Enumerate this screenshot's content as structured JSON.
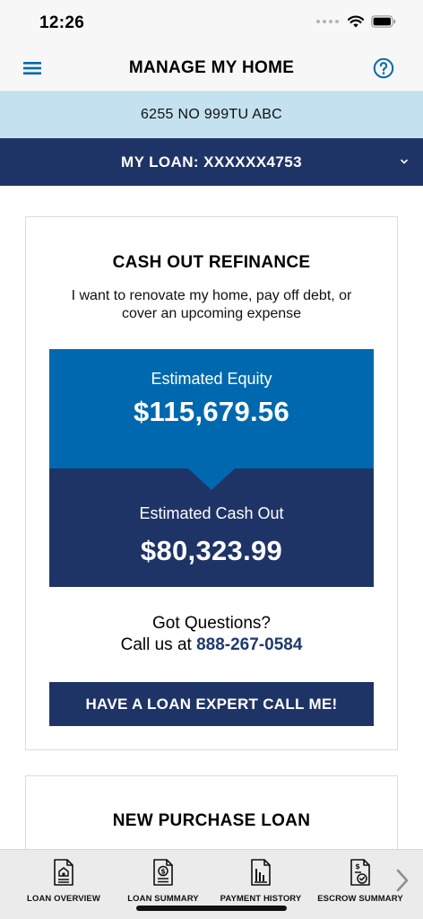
{
  "status_bar": {
    "time": "12:26"
  },
  "header": {
    "title": "MANAGE MY HOME"
  },
  "address": "6255 NO 999TU ABC",
  "loan_selector": {
    "label": "MY LOAN: XXXXXX4753"
  },
  "refinance_card": {
    "title": "CASH OUT REFINANCE",
    "description": "I want to renovate my home, pay off debt, or cover an upcoming expense",
    "equity_label": "Estimated Equity",
    "equity_value": "$115,679.56",
    "cashout_label": "Estimated Cash Out",
    "cashout_value": "$80,323.99",
    "questions_line": "Got Questions?",
    "call_prefix": "Call us at ",
    "phone": "888-267-0584",
    "cta_label": "HAVE A LOAN EXPERT CALL ME!"
  },
  "purchase_card": {
    "title": "NEW PURCHASE LOAN"
  },
  "tab_bar": {
    "items": [
      {
        "label": "LOAN OVERVIEW",
        "icon": "home-document-icon"
      },
      {
        "label": "LOAN SUMMARY",
        "icon": "dollar-document-icon"
      },
      {
        "label": "PAYMENT HISTORY",
        "icon": "chart-document-icon"
      },
      {
        "label": "ESCROW SUMMARY",
        "icon": "escrow-document-icon"
      }
    ],
    "next_icon": "chevron-right-icon"
  },
  "colors": {
    "navy": "#1f3466",
    "blue": "#0068ae",
    "light_blue": "#c3e1ee",
    "link": "#1f3a6e"
  }
}
